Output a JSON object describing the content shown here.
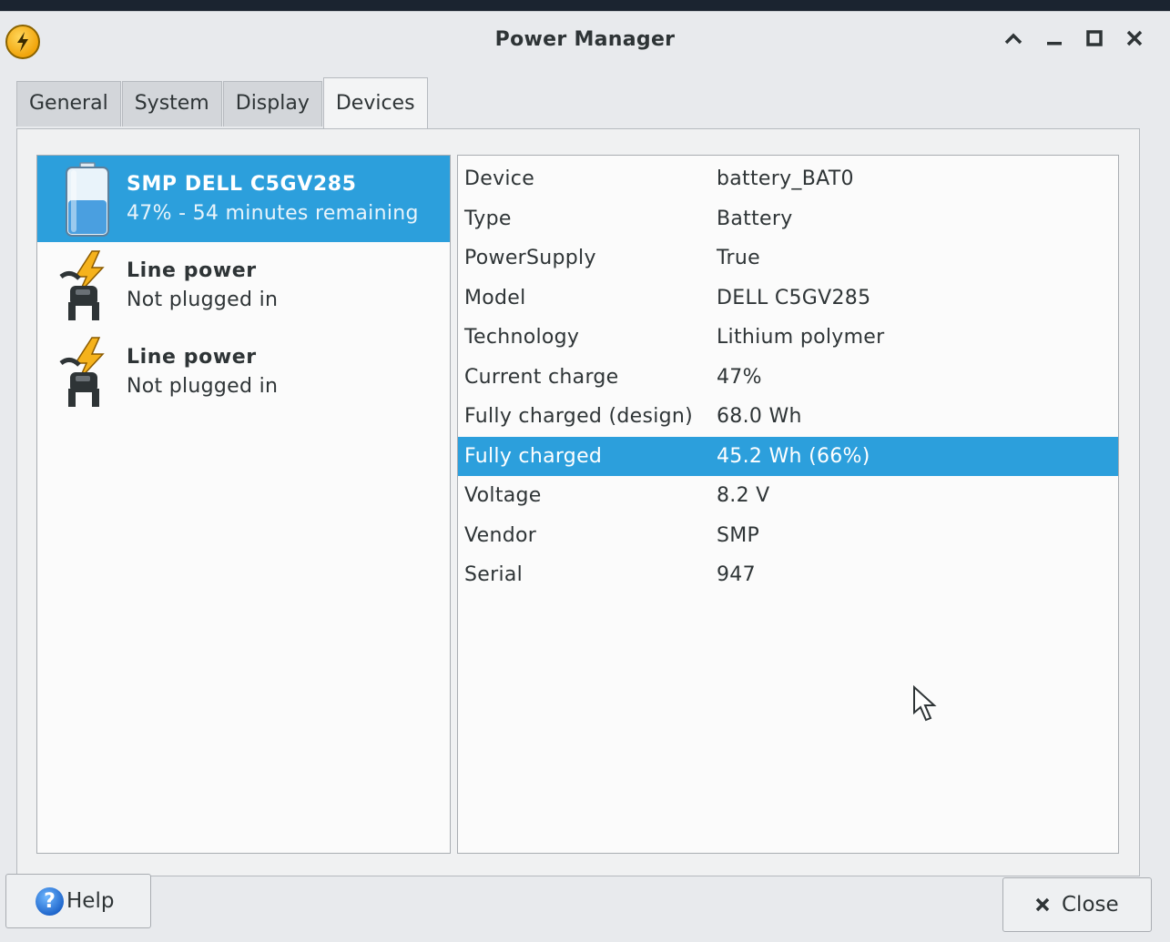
{
  "window": {
    "title": "Power Manager",
    "icons": {
      "app": "lightning-icon",
      "minimize_up": "chevron-up-icon",
      "minimize": "minimize-icon",
      "maximize": "maximize-icon",
      "close": "close-icon"
    }
  },
  "tabs": [
    {
      "label": "General",
      "active": false
    },
    {
      "label": "System",
      "active": false
    },
    {
      "label": "Display",
      "active": false
    },
    {
      "label": "Devices",
      "active": true
    }
  ],
  "devices": [
    {
      "name": "SMP DELL C5GV285",
      "subtitle": "47% - 54 minutes remaining",
      "icon": "battery-icon",
      "selected": true,
      "level_percent": 47
    },
    {
      "name": "Line power",
      "subtitle": "Not plugged in",
      "icon": "ac-plug-icon",
      "selected": false
    },
    {
      "name": "Line power",
      "subtitle": "Not plugged in",
      "icon": "ac-plug-icon",
      "selected": false
    }
  ],
  "properties": [
    {
      "key": "Device",
      "value": "battery_BAT0"
    },
    {
      "key": "Type",
      "value": "Battery"
    },
    {
      "key": "PowerSupply",
      "value": "True"
    },
    {
      "key": "Model",
      "value": "DELL C5GV285"
    },
    {
      "key": "Technology",
      "value": "Lithium polymer"
    },
    {
      "key": "Current charge",
      "value": "47%"
    },
    {
      "key": "Fully charged (design)",
      "value": "68.0 Wh"
    },
    {
      "key": "Fully charged",
      "value": "45.2 Wh (66%)",
      "selected": true
    },
    {
      "key": "Voltage",
      "value": "8.2 V"
    },
    {
      "key": "Vendor",
      "value": "SMP"
    },
    {
      "key": "Serial",
      "value": "947"
    }
  ],
  "buttons": {
    "help_label": "Help",
    "close_label": "Close"
  },
  "colors": {
    "selection": "#2c9fdc",
    "accent_icon": "#f1a50c"
  }
}
